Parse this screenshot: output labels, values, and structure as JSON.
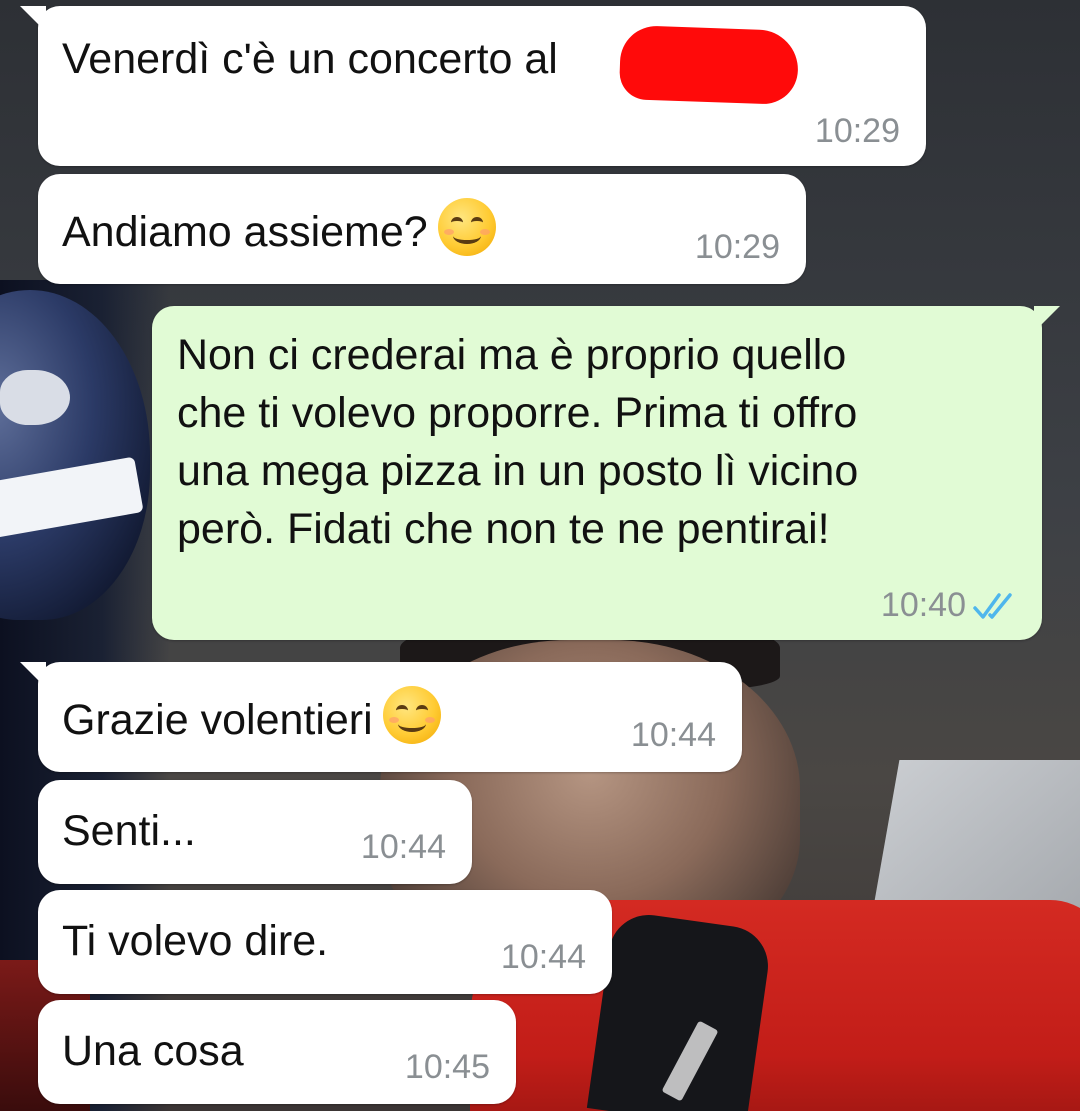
{
  "colors": {
    "incoming_bubble": "#ffffff",
    "outgoing_bubble": "#e1fbd5",
    "timestamp": "#8a8f93",
    "read_ticks": "#4fb6ec",
    "redaction": "#ff0a0a"
  },
  "messages": [
    {
      "direction": "incoming",
      "text": "Venerdì c'è un concerto al",
      "time": "10:29",
      "redacted_tail": true
    },
    {
      "direction": "incoming",
      "text": "Andiamo assieme?",
      "emoji": "smiling-face-with-smiling-eyes",
      "time": "10:29"
    },
    {
      "direction": "outgoing",
      "lines": [
        "Non ci crederai ma è proprio quello",
        "che ti volevo proporre. Prima ti offro",
        "una mega pizza in un posto lì vicino",
        "però. Fidati che non te ne pentirai!"
      ],
      "time": "10:40",
      "status": "read"
    },
    {
      "direction": "incoming",
      "text": "Grazie volentieri",
      "emoji": "smiling-face-with-smiling-eyes",
      "time": "10:44"
    },
    {
      "direction": "incoming",
      "text": "Senti...",
      "time": "10:44"
    },
    {
      "direction": "incoming",
      "text": "Ti volevo dire.",
      "time": "10:44"
    },
    {
      "direction": "incoming",
      "text": "Una cosa",
      "time": "10:45"
    }
  ]
}
